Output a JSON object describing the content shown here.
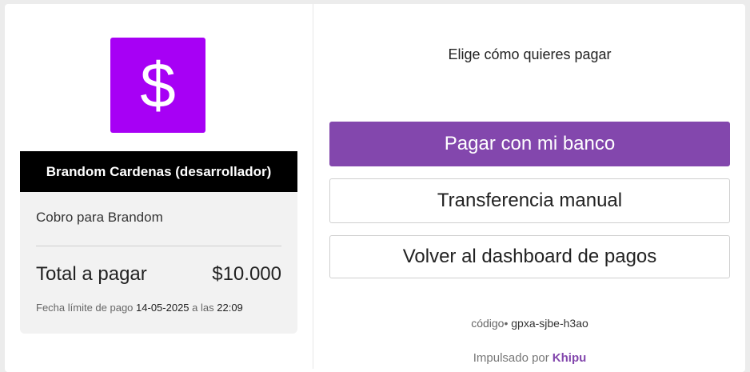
{
  "merchant": {
    "logo_glyph": "$",
    "logo_color": "#a700f5",
    "name": "Brandom Cardenas (desarrollador)"
  },
  "summary": {
    "subject": "Cobro para Brandom",
    "total_label": "Total a pagar",
    "total_amount": "$10.000",
    "deadline_label": "Fecha límite de pago",
    "deadline_date": "14-05-2025",
    "deadline_connector": "a las",
    "deadline_time": "22:09"
  },
  "payment": {
    "heading": "Elige cómo quieres pagar",
    "primary_label": "Pagar con mi banco",
    "manual_label": "Transferencia manual",
    "back_label": "Volver al dashboard de pagos",
    "accent_color": "#8347ad"
  },
  "footer": {
    "code_label": "código",
    "code_value": "gpxa-sjbe-h3ao",
    "powered_label": "Impulsado por",
    "brand": "Khipu"
  }
}
